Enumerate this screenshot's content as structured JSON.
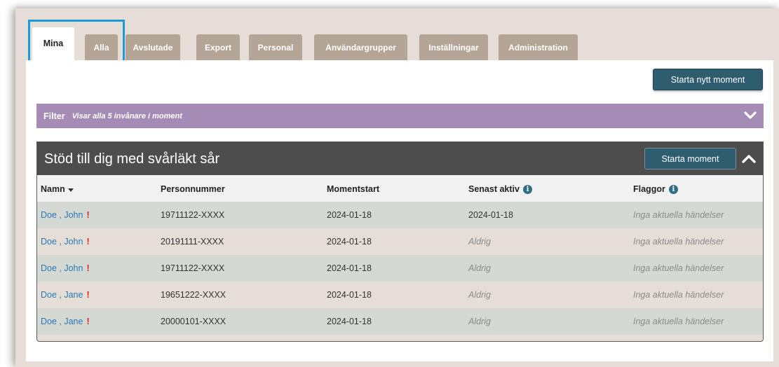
{
  "tabs": [
    {
      "label": "Mina",
      "active": true
    },
    {
      "label": "Alla",
      "active": false
    },
    {
      "label": "Avslutade",
      "active": false
    },
    {
      "label": "Export",
      "active": false
    },
    {
      "label": "Personal",
      "active": false
    },
    {
      "label": "Användargrupper",
      "active": false
    },
    {
      "label": "Inställningar",
      "active": false
    },
    {
      "label": "Administration",
      "active": false
    }
  ],
  "new_moment_button": "Starta nytt moment",
  "filter": {
    "title": "Filter",
    "summary": "Visar alla 5 invånare i moment",
    "icon": "chevron-down-icon"
  },
  "panel": {
    "title": "Stöd till dig med svårläkt sår",
    "start_button": "Starta moment",
    "toggle_icon": "chevron-up-icon"
  },
  "table": {
    "columns": [
      "Namn",
      "Personnummer",
      "Momentstart",
      "Senast aktiv",
      "Flaggor"
    ],
    "rows": [
      {
        "name": "Doe , John",
        "pnr": "19711122-XXXX",
        "start": "2024-01-18",
        "active": "2024-01-18",
        "flags": "Inga aktuella händelser"
      },
      {
        "name": "Doe , John",
        "pnr": "20191111-XXXX",
        "start": "2024-01-18",
        "active": "Aldrig",
        "flags": "Inga aktuella händelser"
      },
      {
        "name": "Doe , John",
        "pnr": "19711122-XXXX",
        "start": "2024-01-18",
        "active": "Aldrig",
        "flags": "Inga aktuella händelser"
      },
      {
        "name": "Doe , Jane",
        "pnr": "19651222-XXXX",
        "start": "2024-01-18",
        "active": "Aldrig",
        "flags": "Inga aktuella händelser"
      },
      {
        "name": "Doe , Jane",
        "pnr": "20000101-XXXX",
        "start": "2024-01-18",
        "active": "Aldrig",
        "flags": "Inga aktuella händelser"
      }
    ]
  },
  "colors": {
    "tab": "#b5a596",
    "button": "#2e5d6f",
    "filter": "#a48cb6",
    "header": "#4d4d4d",
    "highlight": "#1e9ad8",
    "alert": "#e02020"
  }
}
